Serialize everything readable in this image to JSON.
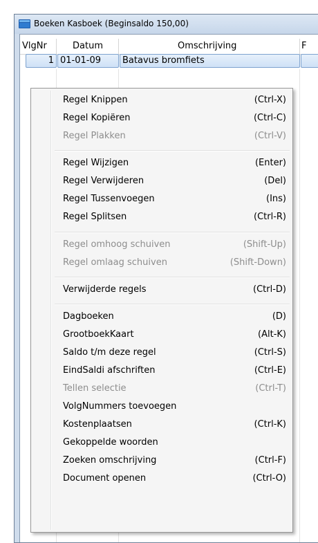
{
  "window": {
    "title": "Boeken Kasboek (Beginsaldo 150,00)"
  },
  "grid": {
    "columns": [
      "VlgNr",
      "Datum",
      "Omschrijving",
      "F"
    ],
    "row": {
      "nr": "1",
      "datum": "01-01-09",
      "omschrijving": "Batavus bromfiets"
    }
  },
  "menu": {
    "items": [
      {
        "label": "Regel Knippen",
        "shortcut": "(Ctrl-X)",
        "enabled": true
      },
      {
        "label": "Regel Kopiëren",
        "shortcut": "(Ctrl-C)",
        "enabled": true
      },
      {
        "label": "Regel Plakken",
        "shortcut": "(Ctrl-V)",
        "enabled": false
      },
      {
        "label": "Regel Wijzigen",
        "shortcut": "(Enter)",
        "enabled": true
      },
      {
        "label": "Regel Verwijderen",
        "shortcut": "(Del)",
        "enabled": true
      },
      {
        "label": "Regel Tussenvoegen",
        "shortcut": "(Ins)",
        "enabled": true
      },
      {
        "label": "Regel Splitsen",
        "shortcut": "(Ctrl-R)",
        "enabled": true
      },
      {
        "label": "Regel omhoog schuiven",
        "shortcut": "(Shift-Up)",
        "enabled": false
      },
      {
        "label": "Regel omlaag schuiven",
        "shortcut": "(Shift-Down)",
        "enabled": false
      },
      {
        "label": "Verwijderde regels",
        "shortcut": "(Ctrl-D)",
        "enabled": true
      },
      {
        "label": "Dagboeken",
        "shortcut": "(D)",
        "enabled": true
      },
      {
        "label": "GrootboekKaart",
        "shortcut": "(Alt-K)",
        "enabled": true
      },
      {
        "label": "Saldo t/m deze regel",
        "shortcut": "(Ctrl-S)",
        "enabled": true
      },
      {
        "label": "EindSaldi afschriften",
        "shortcut": "(Ctrl-E)",
        "enabled": true
      },
      {
        "label": "Tellen selectie",
        "shortcut": "(Ctrl-T)",
        "enabled": false
      },
      {
        "label": "VolgNummers toevoegen",
        "shortcut": "",
        "enabled": true
      },
      {
        "label": "Kostenplaatsen",
        "shortcut": "(Ctrl-K)",
        "enabled": true
      },
      {
        "label": "Gekoppelde woorden",
        "shortcut": "",
        "enabled": true
      },
      {
        "label": "Zoeken omschrijving",
        "shortcut": "(Ctrl-F)",
        "enabled": true
      },
      {
        "label": "Document openen",
        "shortcut": "(Ctrl-O)",
        "enabled": true
      }
    ]
  }
}
